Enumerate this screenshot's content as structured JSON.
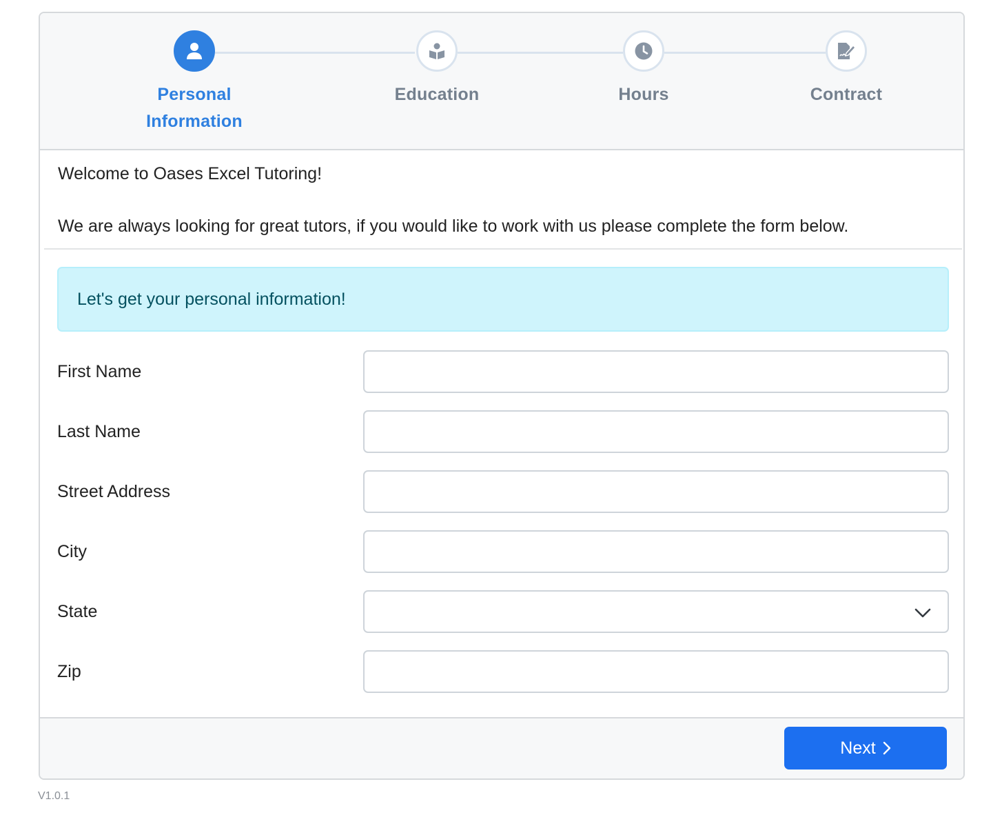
{
  "stepper": {
    "steps": [
      {
        "label_line1": "Personal",
        "label_line2": "Information",
        "icon": "user-icon",
        "state": "active"
      },
      {
        "label": "Education",
        "icon": "book-reader-icon",
        "state": "inactive"
      },
      {
        "label": "Hours",
        "icon": "clock-icon",
        "state": "inactive"
      },
      {
        "label": "Contract",
        "icon": "file-signature-icon",
        "state": "inactive"
      }
    ],
    "colors": {
      "active": "#2f80e0",
      "inactive": "#74808e",
      "line": "#d9e3ee"
    }
  },
  "intro": {
    "welcome": "Welcome to Oases Excel Tutoring!",
    "message": "We are always looking for great tutors, if you would like to work with us please complete the form below."
  },
  "alert": {
    "text": "Let's get your personal information!"
  },
  "form": {
    "first_name": {
      "label": "First Name",
      "value": ""
    },
    "last_name": {
      "label": "Last Name",
      "value": ""
    },
    "street_address": {
      "label": "Street Address",
      "value": ""
    },
    "city": {
      "label": "City",
      "value": ""
    },
    "state": {
      "label": "State",
      "value": ""
    },
    "zip": {
      "label": "Zip",
      "value": ""
    }
  },
  "footer": {
    "next_label": "Next",
    "next_color": "#1c6ff0"
  },
  "version": "V1.0.1"
}
